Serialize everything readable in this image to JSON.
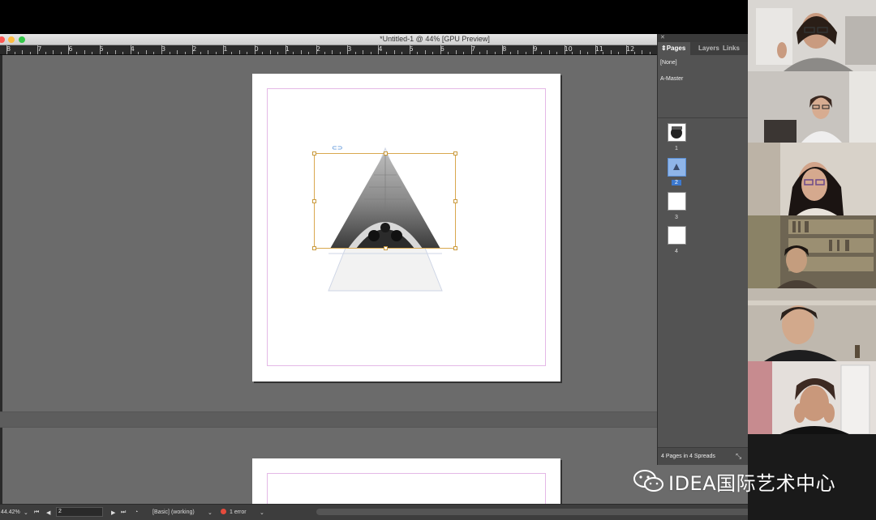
{
  "window": {
    "title": "*Untitled-1 @ 44% [GPU Preview]"
  },
  "ruler": {
    "labels": [
      "8",
      "7",
      "6",
      "5",
      "4",
      "3",
      "2",
      "1",
      "0",
      "1",
      "2",
      "3",
      "4",
      "5",
      "6",
      "7",
      "8",
      "9",
      "10",
      "11",
      "12"
    ]
  },
  "pages_panel": {
    "tabs": [
      "Pages",
      "Layers",
      "Links"
    ],
    "masters": [
      "[None]",
      "A-Master"
    ],
    "pages": [
      "1",
      "2",
      "3",
      "4"
    ],
    "selected_page": "2",
    "footer": "4 Pages in 4 Spreads"
  },
  "status_bar": {
    "zoom": "44.42%",
    "page": "2",
    "preflight_profile": "[Basic] (working)",
    "errors": "1 error"
  },
  "watermark": {
    "text": "IDEA国际艺术中心"
  }
}
